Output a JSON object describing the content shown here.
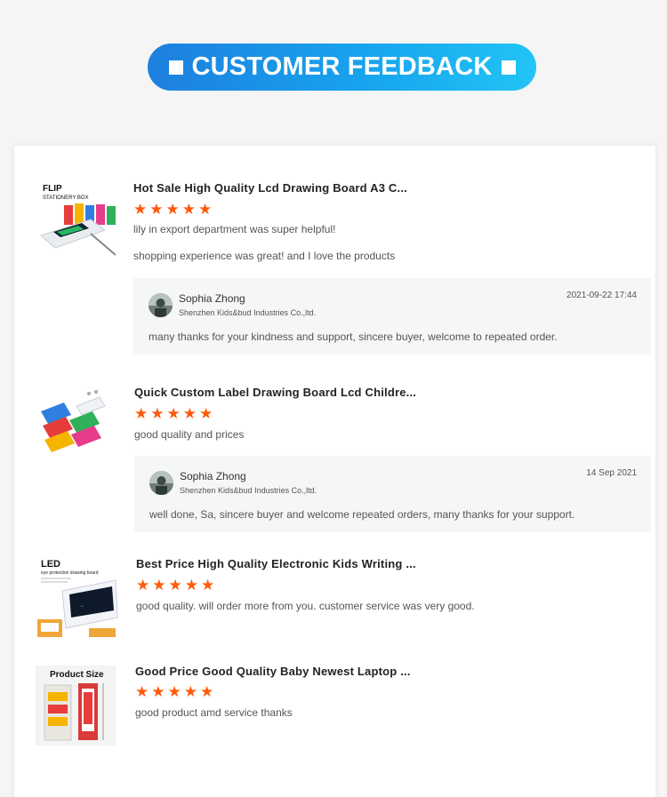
{
  "banner": {
    "title": "CUSTOMER FEEDBACK"
  },
  "reviews": [
    {
      "product_title": "Hot Sale High Quality Lcd Drawing Board A3 C...",
      "rating": 5,
      "thumb_label_1": "FLIP",
      "thumb_label_2": "STATIONERY BOX",
      "texts": [
        "lily in export department was super helpful!",
        "shopping experience was great! and I love the products"
      ],
      "reply": {
        "name": "Sophia Zhong",
        "company": "Shenzhen Kids&bud Industries Co.,ltd.",
        "date": "2021-09-22 17:44",
        "message": "many thanks for your kindness and support, sincere buyer, welcome to repeated order."
      }
    },
    {
      "product_title": "Quick Custom Label Drawing Board Lcd Childre...",
      "rating": 5,
      "texts": [
        "good quality and prices"
      ],
      "reply": {
        "name": "Sophia Zhong",
        "company": "Shenzhen Kids&bud Industries Co.,ltd.",
        "date": "14 Sep 2021",
        "message": "well done, Sa, sincere buyer and welcome repeated orders, many thanks for your support."
      }
    },
    {
      "product_title": "Best Price High Quality Electronic Kids Writing ...",
      "rating": 5,
      "thumb_label_1": "LED",
      "thumb_label_2": "eye protection drawing board",
      "texts": [
        "good quality. will order more from you. customer service was very good."
      ]
    },
    {
      "product_title": "Good Price Good Quality Baby Newest Laptop ...",
      "rating": 5,
      "thumb_label_1": "Product Size",
      "texts": [
        "good product amd service thanks"
      ]
    }
  ],
  "colors": {
    "accent_star": "#ff5a0a",
    "banner_start": "#1e7fde",
    "banner_end": "#22c4f6"
  },
  "icons": {
    "star": "star-icon",
    "square": "square-bullet-icon"
  }
}
